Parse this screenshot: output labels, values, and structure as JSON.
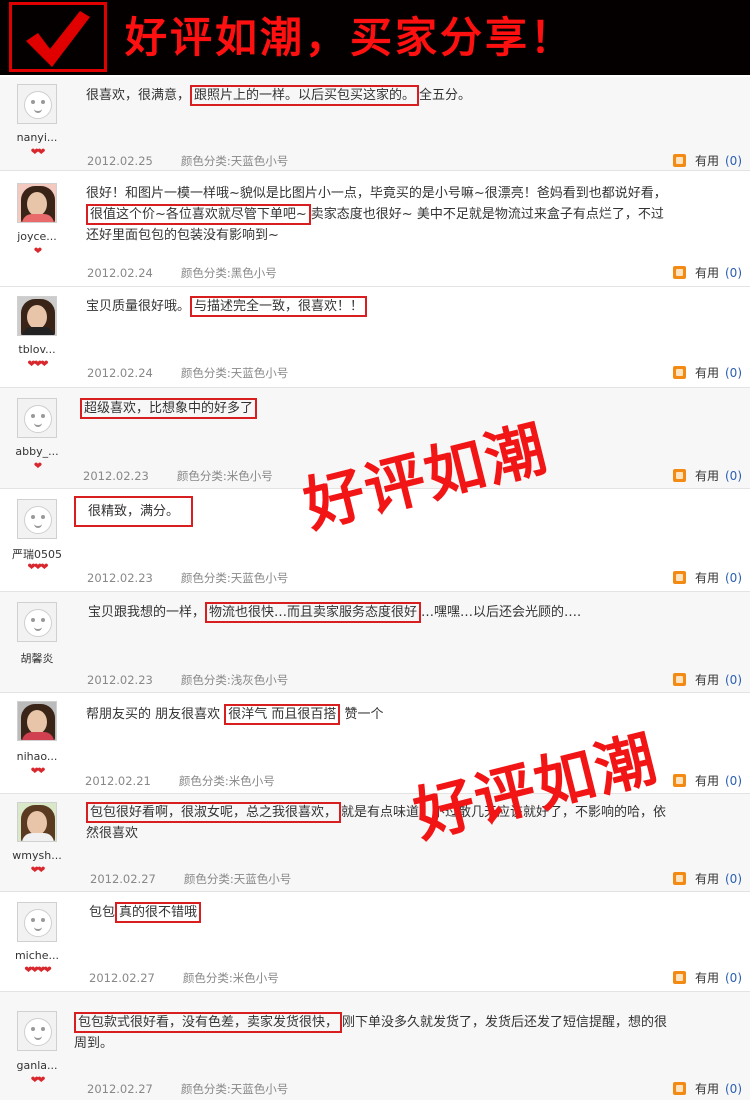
{
  "header": {
    "title": "好评如潮，买家分享！",
    "check_icon": "check-icon",
    "accent": "#ff1010"
  },
  "watermark": "好评如潮",
  "useful_label": "有用",
  "reviews": [
    {
      "user": "nanyi...",
      "hearts": "❤❤",
      "pre": "很喜欢，很满意，",
      "hl": "跟照片上的一样。以后买包买这家的。",
      "post": "全五分。",
      "date": "2012.02.25",
      "category": "颜色分类:天蓝色小号",
      "count": "(0)"
    },
    {
      "user": "joyce...",
      "hearts": "❤",
      "pre": "很好！和图片一模一样哦~貌似是比图片小一点，毕竟买的是小号嘛~很漂亮！爸妈看到也都说好看，",
      "hl": "很值这个价~各位喜欢就尽管下单吧~",
      "post": "卖家态度也很好~ 美中不足就是物流过来盒子有点烂了，不过还好里面包包的包装没有影响到~",
      "date": "2012.02.24",
      "category": "颜色分类:黑色小号",
      "count": "(0)"
    },
    {
      "user": "tblov...",
      "hearts": "❤❤❤",
      "pre": "宝贝质量很好哦。",
      "hl": "与描述完全一致，很喜欢！！",
      "post": "",
      "date": "2012.02.24",
      "category": "颜色分类:天蓝色小号",
      "count": "(0)"
    },
    {
      "user": "abby_...",
      "hearts": "❤",
      "pre": "",
      "hl": "超级喜欢，比想象中的好多了",
      "post": "",
      "date": "2012.02.23",
      "category": "颜色分类:米色小号",
      "count": "(0)"
    },
    {
      "user": "严瑞0505",
      "hearts": "❤❤❤",
      "pre": "",
      "hl": "很精致，满分。",
      "post": "",
      "date": "2012.02.23",
      "category": "颜色分类:天蓝色小号",
      "count": "(0)"
    },
    {
      "user": "胡馨炎",
      "hearts": "",
      "pre": "宝贝跟我想的一样，",
      "hl": "物流也很快…而且卖家服务态度很好",
      "post": "…嘿嘿…以后还会光顾的….",
      "date": "2012.02.23",
      "category": "颜色分类:浅灰色小号",
      "count": "(0)"
    },
    {
      "user": "nihao...",
      "hearts": "❤❤",
      "pre": "帮朋友买的 朋友很喜欢 ",
      "hl": "很洋气 而且很百搭",
      "post": " 赞一个",
      "date": "2012.02.21",
      "category": "颜色分类:米色小号",
      "count": "(0)"
    },
    {
      "user": "wmysh...",
      "hearts": "❤❤",
      "pre": "",
      "hl": "包包很好看啊，很淑女呢，总之我很喜欢，",
      "post": "就是有点味道，不过散几天应该就好了，不影响的哈，依然很喜欢",
      "date": "2012.02.27",
      "category": "颜色分类:天蓝色小号",
      "count": "(0)"
    },
    {
      "user": "miche...",
      "hearts": "❤❤❤❤",
      "pre": "包包",
      "hl": "真的很不错哦",
      "post": "",
      "date": "2012.02.27",
      "category": "颜色分类:米色小号",
      "count": "(0)"
    },
    {
      "user": "ganla...",
      "hearts": "❤❤",
      "pre": "",
      "hl": "包包款式很好看，没有色差，卖家发货很快，",
      "post": "刚下单没多久就发货了，发货后还发了短信提醒，想的很周到。",
      "date": "2012.02.27",
      "category": "颜色分类:天蓝色小号",
      "count": "(0)"
    }
  ]
}
